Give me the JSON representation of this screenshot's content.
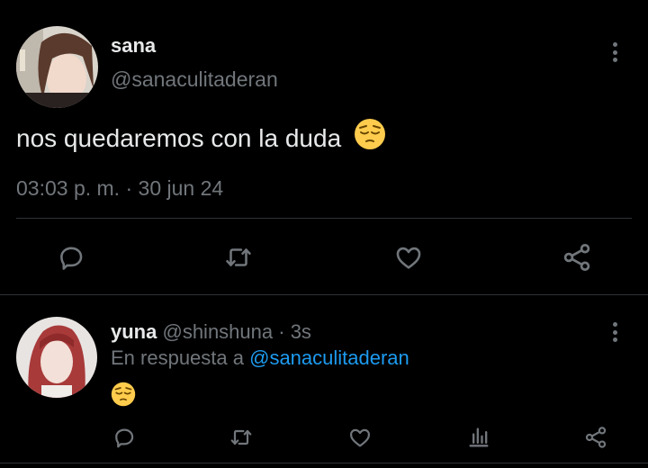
{
  "tweet": {
    "author_name": "sana",
    "author_handle": "@sanaculitaderan",
    "text": "nos quedaremos con la duda",
    "time": "03:03 p. m.",
    "separator": " · ",
    "date": "30 jun 24",
    "actions": [
      "reply-icon",
      "retweet-icon",
      "like-icon",
      "share-icon"
    ]
  },
  "reply": {
    "author_name": "yuna",
    "author_handle": "@shinshuna",
    "separator": " · ",
    "age": "3s",
    "in_reply_prefix": "En respuesta a ",
    "in_reply_mention": "@sanaculitaderan",
    "actions": [
      "reply-icon",
      "retweet-icon",
      "like-icon",
      "views-icon",
      "share-icon"
    ]
  },
  "colors": {
    "background": "#000000",
    "text": "#e7e9ea",
    "secondary": "#71767b",
    "link": "#1d9bf0",
    "divider": "#2f3336"
  }
}
